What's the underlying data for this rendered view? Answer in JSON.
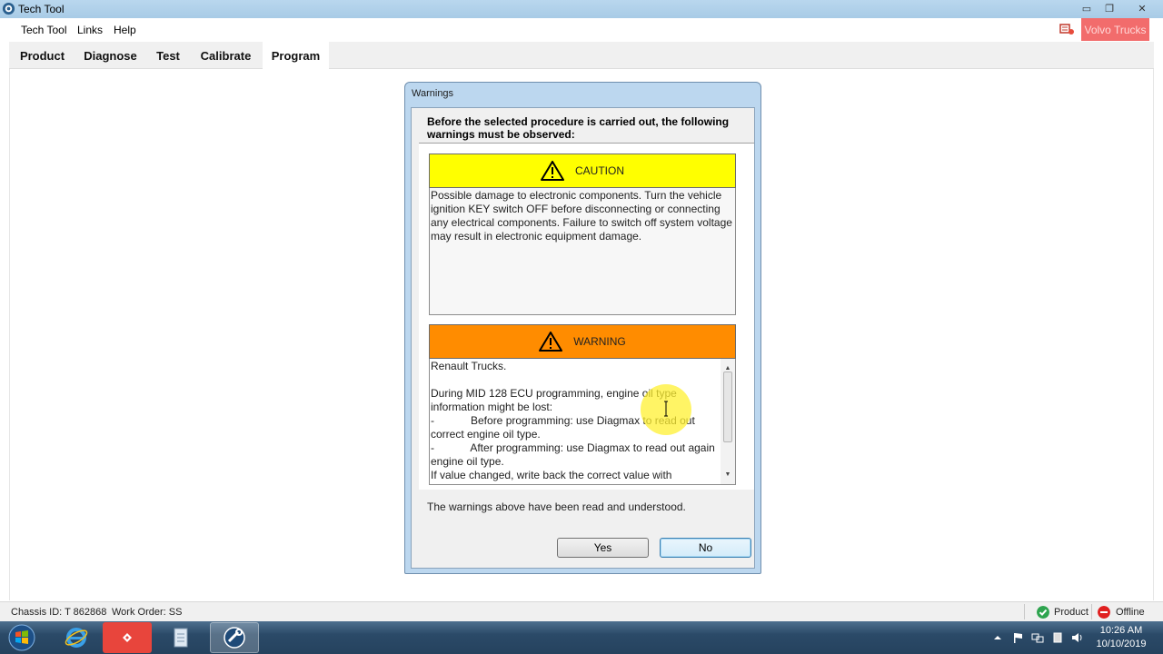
{
  "window": {
    "title": "Tech Tool",
    "controls": {
      "minimize": "▭",
      "maximize": "❐",
      "close": "✕"
    }
  },
  "menubar": {
    "items": [
      "Tech Tool",
      "Links",
      "Help"
    ],
    "brand_label": "Volvo Trucks"
  },
  "tabs": [
    {
      "label": "Product",
      "active": false
    },
    {
      "label": "Diagnose",
      "active": false
    },
    {
      "label": "Test",
      "active": false
    },
    {
      "label": "Calibrate",
      "active": false
    },
    {
      "label": "Program",
      "active": true
    }
  ],
  "dialog": {
    "title": "Warnings",
    "intro": "Before the selected procedure is carried out, the following warnings must be observed:",
    "caution": {
      "label": "CAUTION",
      "color": "#ffff00",
      "text": "Possible damage to electronic components. Turn the vehicle ignition KEY switch OFF before disconnecting or connecting any electrical components. Failure to switch off system voltage may result in electronic equipment damage."
    },
    "warning": {
      "label": "WARNING",
      "color": "#ff8c00",
      "text": "Renault Trucks.\n\nDuring MID 128 ECU programming, engine oil type information might be lost:\n-            Before programming: use Diagmax to read out correct engine oil type.\n-            After programming: use Diagmax to read out again engine oil type.\nIf value changed, write back the correct value with Diagmax."
    },
    "ack_text": "The warnings above have been read and understood.",
    "yes_label": "Yes",
    "no_label": "No"
  },
  "statusbar": {
    "chassis": "Chassis ID: T 862868",
    "work_order": "Work Order: SS",
    "product_status": "Product",
    "connection_status": "Offline"
  },
  "taskbar": {
    "time": "10:26 AM",
    "date": "10/10/2019"
  }
}
